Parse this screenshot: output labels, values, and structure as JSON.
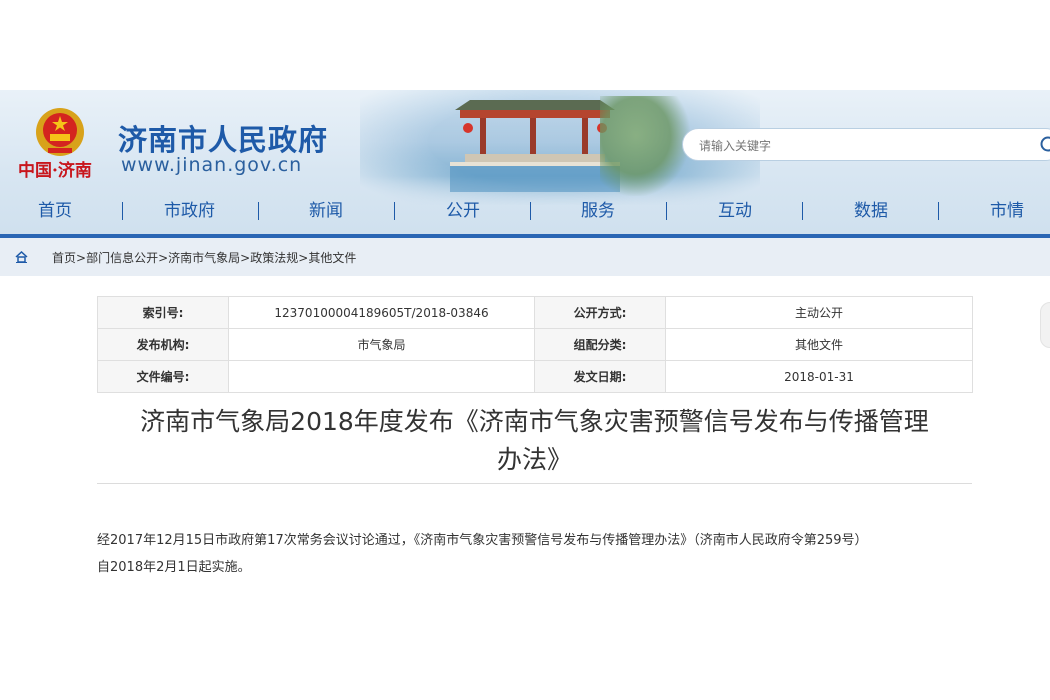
{
  "header": {
    "logo_text": "中国·济南",
    "site_name": "济南市人民政府",
    "site_url": "www.jinan.gov.cn",
    "search_placeholder": "请输入关键字",
    "colors": {
      "brand_blue": "#1e5aa8",
      "logo_red": "#c8161d"
    }
  },
  "nav": {
    "items": [
      "首页",
      "市政府",
      "新闻",
      "公开",
      "服务",
      "互动",
      "数据",
      "市情"
    ],
    "separator": "|"
  },
  "breadcrumb": {
    "items": [
      "首页",
      "部门信息公开",
      "济南市气象局",
      "政策法规",
      "其他文件"
    ],
    "separator": ">"
  },
  "info_table": {
    "rows": [
      {
        "label1": "索引号:",
        "value1": "12370100004189605T/2018-03846",
        "label2": "公开方式:",
        "value2": "主动公开"
      },
      {
        "label1": "发布机构:",
        "value1": "市气象局",
        "label2": "组配分类:",
        "value2": "其他文件"
      },
      {
        "label1": "文件编号:",
        "value1": "",
        "label2": "发文日期:",
        "value2": "2018-01-31"
      }
    ]
  },
  "article": {
    "title_line1": "济南市气象局2018年度发布《济南市气象灾害预警信号发布与传播管理",
    "title_line2": "办法》",
    "body_line1": "经2017年12月15日市政府第17次常务会议讨论通过，《济南市气象灾害预警信号发布与传播管理办法》（济南市人民政府令第259号）",
    "body_line2": "自2018年2月1日起实施。"
  }
}
